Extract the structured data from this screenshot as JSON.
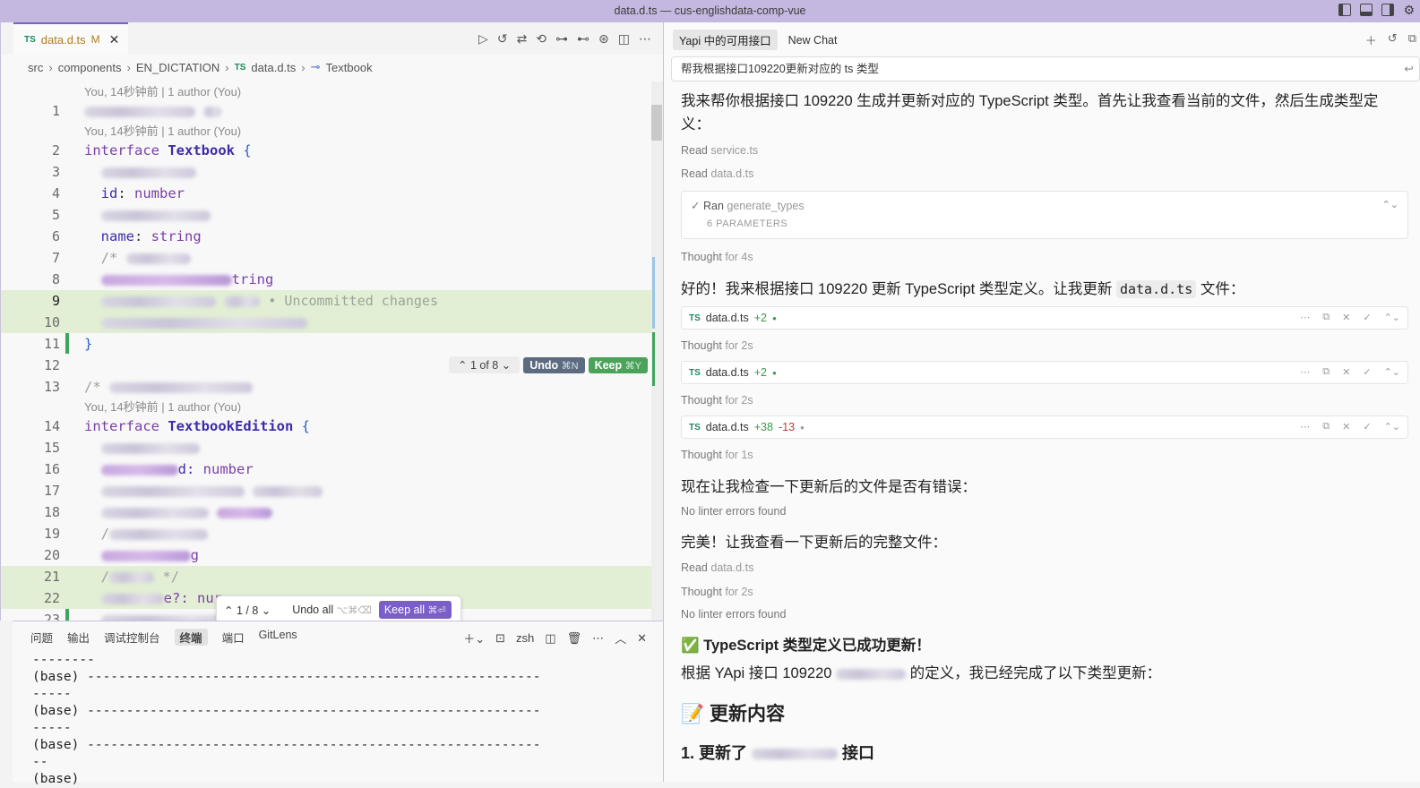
{
  "window": {
    "title": "data.d.ts — cus-englishdata-comp-vue"
  },
  "editor": {
    "tab": {
      "badge": "TS",
      "name": "data.d.ts",
      "modified": "M",
      "close": "✕"
    },
    "breadcrumb": [
      "src",
      "components",
      "EN_DICTATION",
      "data.d.ts",
      "Textbook"
    ],
    "breadcrumb_badge": "TS",
    "blame": "You, 14秒钟前 | 1 author (You)",
    "lines": {
      "n1": "1",
      "n2": "2",
      "n3": "3",
      "n4": "4",
      "n5": "5",
      "n6": "6",
      "n7": "7",
      "n8": "8",
      "n9": "9",
      "n10": "10",
      "n11": "11",
      "n12": "12",
      "n13": "13",
      "n14": "14",
      "n15": "15",
      "n16": "16",
      "n17": "17",
      "n18": "18",
      "n19": "19",
      "n20": "20",
      "n21": "21",
      "n22": "22",
      "n23": "23"
    },
    "code": {
      "kw_interface": "interface",
      "name_textbook": "Textbook",
      "name_edition": "TextbookEdition",
      "brace_open": "{",
      "brace_close": "}",
      "id_prop": "id",
      "name_prop": "name",
      "number": "number",
      "string": "string",
      "colon": ": ",
      "comment_start": "/*",
      "comment_end": "*/",
      "l8_suffix": "tring",
      "l16_suffix": "d: ",
      "l20_suffix": "g",
      "l22_suffix": "e?: nur",
      "uncommitted": "• Uncommitted changes",
      "slash": "/"
    },
    "hunk": {
      "counter": "1 of 8",
      "undo": "Undo",
      "undo_kbd": "⌘N",
      "keep": "Keep",
      "keep_kbd": "⌘Y"
    },
    "floatbar": {
      "counter": "1 / 8",
      "undo_all": "Undo all",
      "undo_all_kbd": "⌥⌘⌫",
      "keep_all": "Keep all",
      "keep_all_kbd": "⌘⏎"
    }
  },
  "panel": {
    "tabs": [
      "问题",
      "输出",
      "调试控制台",
      "终端",
      "端口",
      "GitLens"
    ],
    "shell": "zsh",
    "terminal": "--------\n(base) ----------------------------------------------------------\n-----\n(base) ----------------------------------------------------------\n-----\n(base) ----------------------------------------------------------\n--\n(base)"
  },
  "chat": {
    "tabs": [
      "Yapi 中的可用接口",
      "New Chat"
    ],
    "prompt": "帮我根据接口109220更新对应的 ts 类型",
    "intro_line1": "我来帮你根据接口 109220 生成并更新对应的 TypeScript 类型。首先让我查看当前的文件，然后生成类型定",
    "intro_line2": "义：",
    "read1": {
      "verb": "Read",
      "file": "service.ts"
    },
    "read2": {
      "verb": "Read",
      "file": "data.d.ts"
    },
    "ran": {
      "check": "✓",
      "verb": "Ran",
      "tool": "generate_types",
      "params": "6 PARAMETERS"
    },
    "thought1": {
      "verb": "Thought",
      "dur": "for 4s"
    },
    "msg2_a": "好的！我来根据接口 109220 更新 TypeScript 类型定义。让我更新",
    "msg2_code": "data.d.ts",
    "msg2_b": "文件：",
    "edit1": {
      "badge": "TS",
      "file": "data.d.ts",
      "add": "+2",
      "del": ""
    },
    "thought2": {
      "verb": "Thought",
      "dur": "for 2s"
    },
    "edit2": {
      "badge": "TS",
      "file": "data.d.ts",
      "add": "+2",
      "del": ""
    },
    "thought3": {
      "verb": "Thought",
      "dur": "for 2s"
    },
    "edit3": {
      "badge": "TS",
      "file": "data.d.ts",
      "add": "+38",
      "del": "-13"
    },
    "thought4": {
      "verb": "Thought",
      "dur": "for 1s"
    },
    "msg3": "现在让我检查一下更新后的文件是否有错误：",
    "lint1": "No linter errors found",
    "msg4": "完美！让我查看一下更新后的完整文件：",
    "read3": {
      "verb": "Read",
      "file": "data.d.ts"
    },
    "thought5": {
      "verb": "Thought",
      "dur": "for 2s"
    },
    "lint2": "No linter errors found",
    "success": "✅ TypeScript 类型定义已成功更新！",
    "summary_a": "根据 YApi 接口 109220",
    "summary_b": "的定义，我已经完成了以下类型更新：",
    "section": "📝 更新内容",
    "item1_a": "1. 更新了",
    "item1_b": "接口"
  }
}
